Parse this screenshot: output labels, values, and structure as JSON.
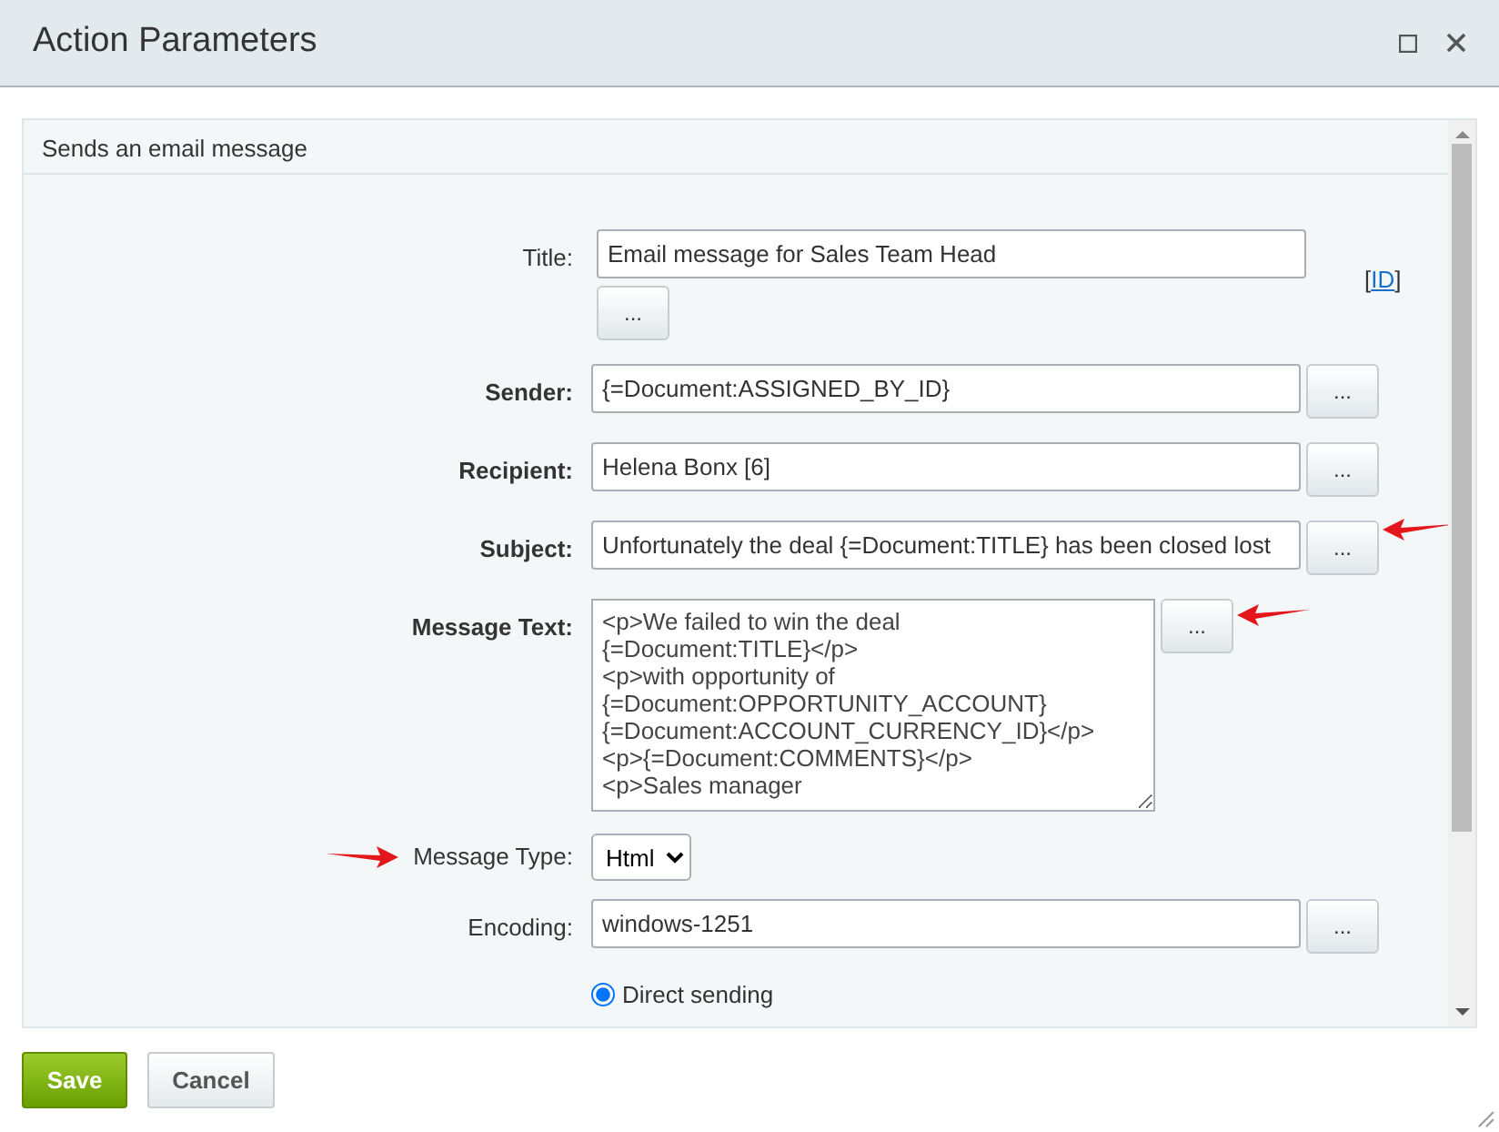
{
  "dialog": {
    "title": "Action Parameters"
  },
  "description": "Sends an email message",
  "fields": [
    {
      "kind": "input",
      "label": "Title:",
      "required": false,
      "value": "Email message for Sales Team Head",
      "button": "...",
      "button_below": true,
      "link_open": "[",
      "link": "ID",
      "link_close": "]"
    },
    {
      "kind": "input",
      "label": "Sender:",
      "required": true,
      "value": "{=Document:ASSIGNED_BY_ID}",
      "button": "..."
    },
    {
      "kind": "input",
      "label": "Recipient:",
      "required": true,
      "value": "Helena Bonx [6]",
      "button": "..."
    },
    {
      "kind": "input",
      "label": "Subject:",
      "required": true,
      "value": "Unfortunately the deal {=Document:TITLE} has been closed lost",
      "button": "...",
      "arrow_after_button": true
    },
    {
      "kind": "textarea",
      "label": "Message Text:",
      "required": true,
      "value": "<p>We failed to win the deal\n{=Document:TITLE}</p>\n<p>with opportunity of\n{=Document:OPPORTUNITY_ACCOUNT}\n{=Document:ACCOUNT_CURRENCY_ID}</p>\n<p>{=Document:COMMENTS}</p>\n<p>Sales manager",
      "button": "...",
      "arrow_after_button": true
    },
    {
      "kind": "select",
      "label": "Message Type:",
      "required": false,
      "value": "Html",
      "arrow_before_label": true
    },
    {
      "kind": "input",
      "label": "Encoding:",
      "required": false,
      "value": "windows-1251",
      "button": "..."
    },
    {
      "kind": "radio",
      "options": [
        {
          "label": "Direct sending",
          "selected": true
        }
      ]
    }
  ],
  "footer": [
    {
      "label": "Save",
      "primary": true
    },
    {
      "label": "Cancel",
      "primary": false
    }
  ]
}
